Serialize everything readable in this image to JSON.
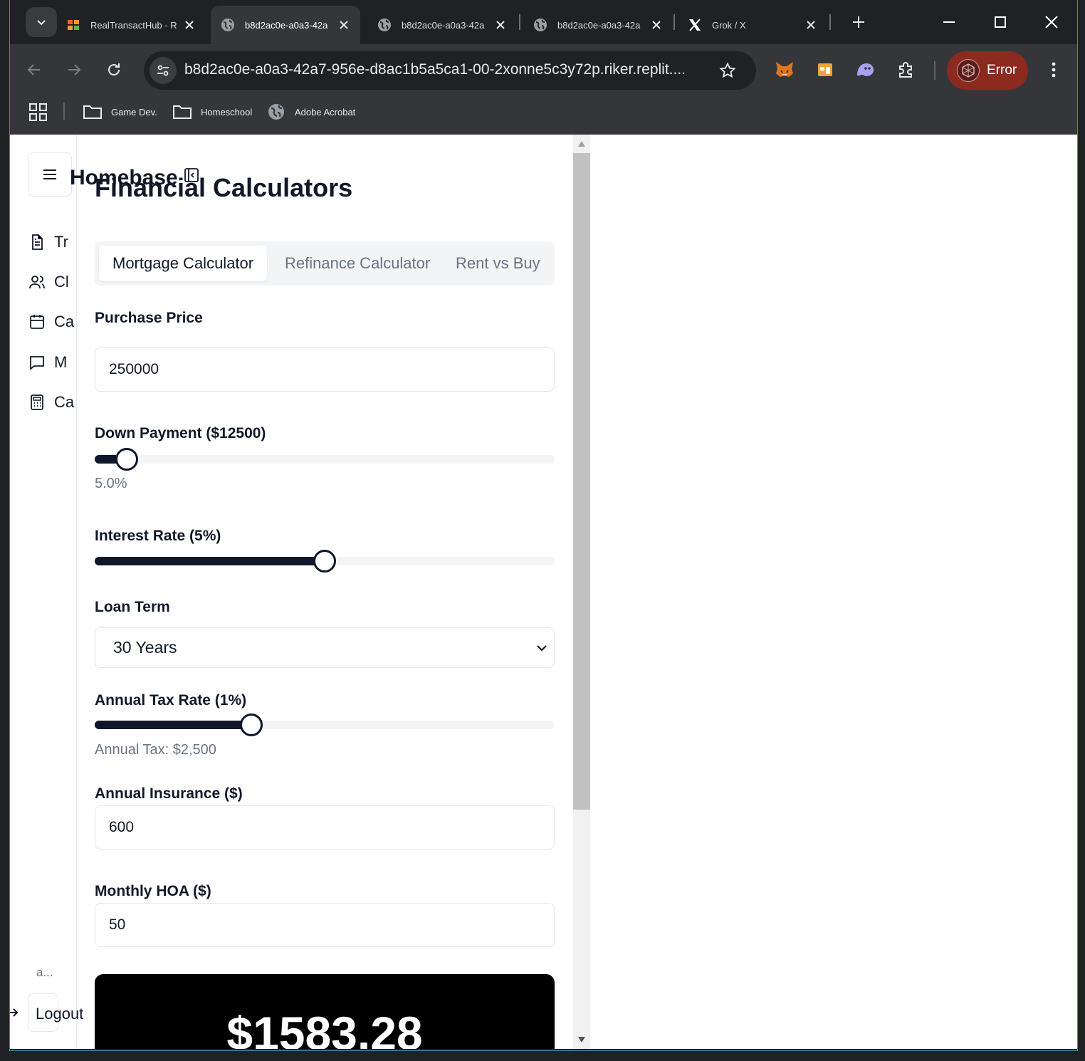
{
  "browser": {
    "tabs": [
      {
        "title": "RealTransactHub - R",
        "icon": "realtransacthub-favicon",
        "active": false
      },
      {
        "title": "b8d2ac0e-a0a3-42a",
        "icon": "globe-icon",
        "active": true
      },
      {
        "title": "b8d2ac0e-a0a3-42a",
        "icon": "globe-icon",
        "active": false
      },
      {
        "title": "b8d2ac0e-a0a3-42a",
        "icon": "globe-icon",
        "active": false
      },
      {
        "title": "Grok / X",
        "icon": "x-logo-icon",
        "active": false
      }
    ],
    "url": "b8d2ac0e-a0a3-42a7-956e-d8ac1b5a5ca1-00-2xonne5c3y72p.riker.replit....",
    "profile_status": "Error",
    "bookmarks": [
      {
        "label": "Game Dev.",
        "icon": "folder-icon"
      },
      {
        "label": "Homeschool",
        "icon": "folder-icon"
      },
      {
        "label": "Adobe Acrobat",
        "icon": "globe-icon"
      }
    ]
  },
  "app": {
    "brand": "Homebase",
    "sidebar": {
      "items": [
        {
          "label": "Tr",
          "icon": "file-text-icon"
        },
        {
          "label": "Cl",
          "icon": "users-icon"
        },
        {
          "label": "Ca",
          "icon": "calendar-icon"
        },
        {
          "label": "M",
          "icon": "message-icon"
        },
        {
          "label": "Ca",
          "icon": "calculator-icon"
        }
      ],
      "user": "a...",
      "logout": "Logout"
    },
    "page_title": "Financial Calculators",
    "tabs": [
      "Mortgage Calculator",
      "Refinance Calculator",
      "Rent vs Buy"
    ],
    "active_tab": "Mortgage Calculator",
    "form": {
      "purchase_price_label": "Purchase Price",
      "purchase_price_value": "250000",
      "down_payment_label": "Down Payment ($12500)",
      "down_payment_percent_text": "5.0%",
      "down_payment_slider_level": 0.07,
      "interest_rate_label": "Interest Rate (5%)",
      "interest_rate_slider_level": 0.5,
      "loan_term_label": "Loan Term",
      "loan_term_value": "30 Years",
      "tax_rate_label": "Annual Tax Rate (1%)",
      "tax_rate_slider_level": 0.34,
      "annual_tax_text": "Annual Tax: $2,500",
      "insurance_label": "Annual Insurance ($)",
      "insurance_value": "600",
      "hoa_label": "Monthly HOA ($)",
      "hoa_value": "50"
    },
    "result": {
      "monthly_payment": "$1583.28"
    }
  },
  "colors": {
    "accent": "#0f172a",
    "profile_error": "#8c2a20",
    "active_tab_bg": "#35363a"
  }
}
